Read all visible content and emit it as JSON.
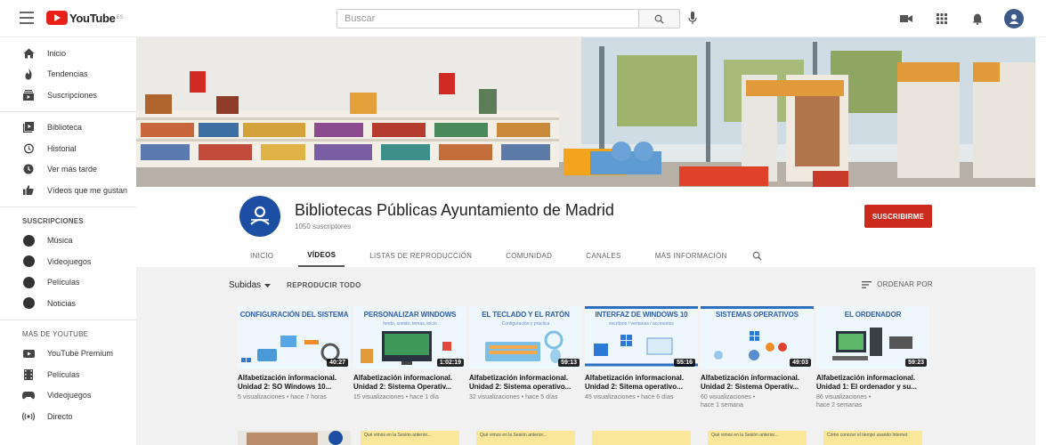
{
  "topbar": {
    "logo_text": "YouTube",
    "logo_region": "ES",
    "search_placeholder": "Buscar"
  },
  "sidebar": {
    "main": [
      {
        "label": "Inicio",
        "icon": "home-icon"
      },
      {
        "label": "Tendencias",
        "icon": "flame-icon"
      },
      {
        "label": "Suscripciones",
        "icon": "subscriptions-icon"
      }
    ],
    "library": [
      {
        "label": "Biblioteca",
        "icon": "library-icon"
      },
      {
        "label": "Historial",
        "icon": "history-icon"
      },
      {
        "label": "Ver más tarde",
        "icon": "clock-icon"
      },
      {
        "label": "Vídeos que me gustan",
        "icon": "thumbs-up-icon"
      }
    ],
    "subs_header": "SUSCRIPCIONES",
    "subs": [
      {
        "label": "Música"
      },
      {
        "label": "Videojuegos"
      },
      {
        "label": "Películas"
      },
      {
        "label": "Noticias"
      }
    ],
    "more_header": "MÁS DE YOUTUBE",
    "more": [
      {
        "label": "YouTube Premium",
        "icon": "youtube-icon"
      },
      {
        "label": "Películas",
        "icon": "film-icon"
      },
      {
        "label": "Videojuegos",
        "icon": "gamepad-icon"
      },
      {
        "label": "Directo",
        "icon": "live-icon"
      }
    ]
  },
  "channel": {
    "name": "Bibliotecas Públicas Ayuntamiento de Madrid",
    "subscribers": "1050 suscriptores",
    "subscribe_label": "SUSCRIBIRME",
    "tabs": [
      "INICIO",
      "VÍDEOS",
      "LISTAS DE REPRODUCCIÓN",
      "COMUNIDAD",
      "CANALES",
      "MÁS INFORMACIÓN"
    ],
    "active_tab": "VÍDEOS"
  },
  "content": {
    "uploads_label": "Subidas",
    "play_all_label": "REPRODUCIR TODO",
    "sort_label": "ORDENAR POR",
    "videos": [
      {
        "thumb_title": "CONFIGURACIÓN DEL SISTEMA",
        "thumb_sub": "",
        "duration": "40:27",
        "title": "Alfabetización informacional. Unidad 2: SO Windows 10...",
        "views": "5 visualizaciones",
        "age": "hace 7 horas"
      },
      {
        "thumb_title": "PERSONALIZAR WINDOWS",
        "thumb_sub": "fondo, sonido, temas, inicio",
        "duration": "1:02:19",
        "title": "Alfabetización informacional. Unidad 2: Sistema Operativ...",
        "views": "15 visualizaciones",
        "age": "hace 1 día"
      },
      {
        "thumb_title": "EL TECLADO Y EL RATÓN",
        "thumb_sub": "Configuración y práctica",
        "duration": "59:13",
        "title": "Alfabetización informacional. Unidad 2: Sistema operativo...",
        "views": "32 visualizaciones",
        "age": "hace 5 días"
      },
      {
        "thumb_title": "INTERFAZ DE WINDOWS 10",
        "thumb_sub": "escritorio / ventanas / accesorios",
        "duration": "55:16",
        "title": "Alfabetización informacional. Unidad 2: Sitema operativo...",
        "views": "45 visualizaciones",
        "age": "hace 6 días"
      },
      {
        "thumb_title": "SISTEMAS OPERATIVOS",
        "thumb_sub": "",
        "duration": "49:03",
        "title": "Alfabetización informacional. Unidad 2: Sistema Operativ...",
        "views": "60 visualizaciones",
        "age": "hace 1 semana"
      },
      {
        "thumb_title": "EL ORDENADOR",
        "thumb_sub": "",
        "duration": "59:23",
        "title": "Alfabetización informacional. Unidad 1: El ordenador y su...",
        "views": "86 visualizaciones",
        "age": "hace 2 semanas"
      }
    ],
    "row2_snippets": [
      "",
      "Qué vimos en la Sesión anterior...",
      "Qué vimos en la Sesión anterior...",
      "",
      "Qué vimos en la Sesión anterior...",
      "Cómo conocer el tiempo usando Internet"
    ]
  },
  "colors": {
    "brand_red": "#e62117",
    "subscribe_red": "#cc2a1d",
    "channel_blue": "#1c4ea4",
    "thumb_title_blue": "#2d5da9"
  }
}
